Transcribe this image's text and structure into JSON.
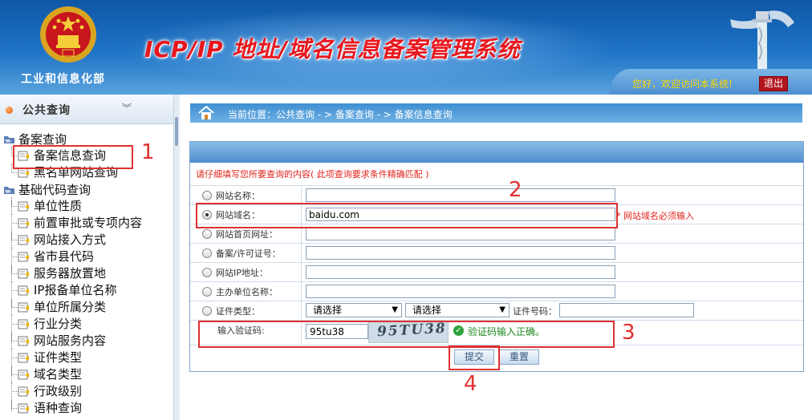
{
  "header": {
    "ministry": "工业和信息化部",
    "title": "ICP/IP 地址/域名信息备案管理系统",
    "welcome": "您好，欢迎访问本系统!",
    "logout": "退出"
  },
  "sidebar": {
    "title": "公共查询",
    "groups": [
      {
        "label": "备案查询",
        "items": [
          "备案信息查询",
          "黑名单网站查询"
        ]
      },
      {
        "label": "基础代码查询",
        "items": [
          "单位性质",
          "前置审批或专项内容",
          "网站接入方式",
          "省市县代码",
          "服务器放置地",
          "IP报备单位名称",
          "单位所属分类",
          "行业分类",
          "网站服务内容",
          "证件类型",
          "域名类型",
          "行政级别",
          "语种查询"
        ]
      }
    ]
  },
  "breadcrumb": "当前位置：公共查询 - > 备案查询 - > 备案信息查询",
  "form": {
    "hint": "请仔细填写您所要查询的内容( 此项查询要求条件精确匹配 )",
    "fields": [
      {
        "label": "网站名称：",
        "value": "",
        "checked": false
      },
      {
        "label": "网站域名：",
        "value": "baidu.com",
        "checked": true
      },
      {
        "label": "网站首页网址：",
        "value": "",
        "checked": false
      },
      {
        "label": "备案/许可证号：",
        "value": "",
        "checked": false
      },
      {
        "label": "网站IP地址：",
        "value": "",
        "checked": false
      },
      {
        "label": "主办单位名称：",
        "value": "",
        "checked": false
      }
    ],
    "cert": {
      "label": "证件类型：",
      "select1": "请选择",
      "select2": "请选择",
      "number_label": "证件号码："
    },
    "required_note": "* 网站域名必须输入",
    "captcha": {
      "label": "输入验证码:",
      "value": "95tu38",
      "image_text": "95TU38",
      "status": "验证码输入正确。"
    },
    "submit": "提交",
    "reset": "重置"
  },
  "annotations": [
    "1",
    "2",
    "3",
    "4"
  ],
  "colors": {
    "header": "#1e73c6",
    "title_red": "#e8161d",
    "annotation_red": "#e03030",
    "welcome_yellow": "#ffd800"
  }
}
